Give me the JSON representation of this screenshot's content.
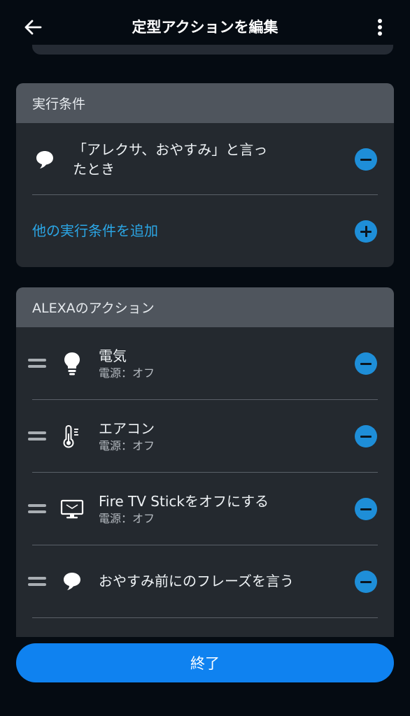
{
  "header": {
    "title": "定型アクションを編集",
    "back_icon": "arrow-left-icon",
    "more_icon": "more-vertical-icon"
  },
  "trigger_card": {
    "title": "実行条件",
    "trigger": {
      "icon": "speech-bubble-icon",
      "text_line1": "「アレクサ、おやすみ」と言っ",
      "text_line2": "たとき"
    },
    "add_label": "他の実行条件を追加"
  },
  "actions_card": {
    "title": "ALEXAのアクション",
    "items": [
      {
        "icon": "light-bulb-icon",
        "title": "電気",
        "subtitle": "電源：オフ"
      },
      {
        "icon": "thermometer-icon",
        "title": "エアコン",
        "subtitle": "電源：オフ"
      },
      {
        "icon": "tv-icon",
        "title": "Fire TV Stickをオフにする",
        "subtitle": "電源：オフ"
      },
      {
        "icon": "speech-bubble-icon",
        "title": "おやすみ前にのフレーズを言う",
        "subtitle": ""
      }
    ]
  },
  "footer": {
    "done_label": "終了"
  },
  "colors": {
    "background": "#050b12",
    "card": "#24292f",
    "card_header": "#4f555d",
    "accent": "#1e8ed8",
    "link": "#2ba6e6",
    "primary_button": "#0f82f0"
  }
}
